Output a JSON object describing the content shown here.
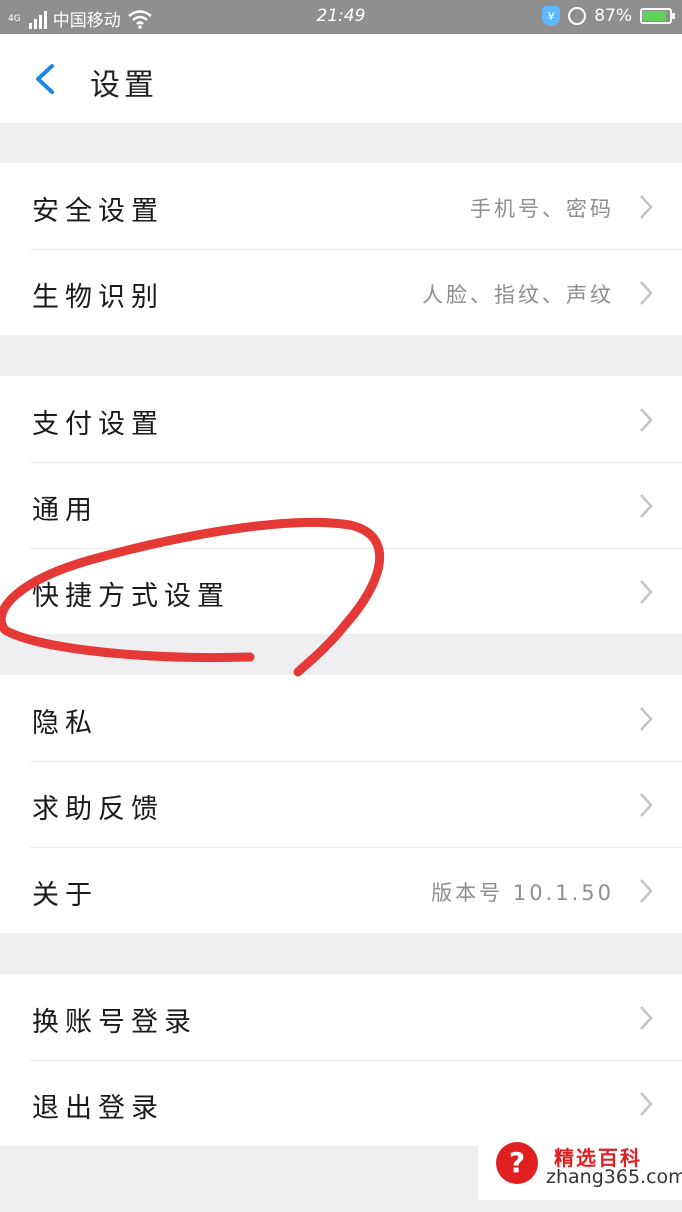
{
  "status_bar": {
    "network": "4G",
    "carrier": "中国移动",
    "time": "21:49",
    "battery": "87%",
    "battery_level": 0.87,
    "icons": [
      "signal-icon",
      "wifi-icon",
      "shield-yuan-icon",
      "rotation-lock-icon",
      "battery-icon"
    ]
  },
  "header": {
    "back_icon": "chevron-left-icon",
    "title": "设置"
  },
  "groups": [
    {
      "rows": [
        {
          "label": "安全设置",
          "value": "手机号、密码"
        },
        {
          "label": "生物识别",
          "value": "人脸、指纹、声纹"
        }
      ]
    },
    {
      "rows": [
        {
          "label": "支付设置",
          "value": ""
        },
        {
          "label": "通用",
          "value": ""
        },
        {
          "label": "快捷方式设置",
          "value": ""
        }
      ]
    },
    {
      "rows": [
        {
          "label": "隐私",
          "value": ""
        },
        {
          "label": "求助反馈",
          "value": ""
        },
        {
          "label": "关于",
          "value": "版本号 10.1.50"
        }
      ]
    },
    {
      "rows": [
        {
          "label": "换账号登录",
          "value": ""
        },
        {
          "label": "退出登录",
          "value": ""
        }
      ]
    }
  ],
  "watermark": {
    "icon_text": "?",
    "brand": "精选百科",
    "url": "zhang365.com"
  },
  "colors": {
    "accent": "#1e88e5",
    "annotation": "#e53935",
    "background": "#efeff1"
  }
}
